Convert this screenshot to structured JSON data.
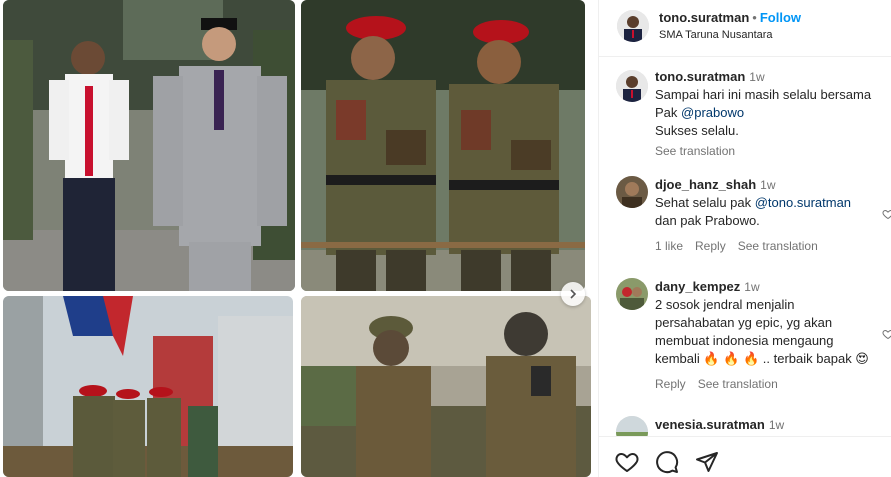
{
  "post": {
    "username": "tono.suratman",
    "separator": "•",
    "follow_label": "Follow",
    "location": "SMA Taruna Nusantara"
  },
  "comments": [
    {
      "username": "tono.suratman",
      "time": "1w",
      "lines": [
        "Sampai hari ini masih selalu bersama",
        "Pak @prabowo",
        "Sukses selalu."
      ],
      "see_translation": "See translation"
    },
    {
      "username": "djoe_hanz_shah",
      "time": "1w",
      "line1_pre": "Sehat selalu pak ",
      "line1_mention": "@tono.suratman",
      "line2": "dan pak Prabowo.",
      "likes": "1 like",
      "reply": "Reply",
      "see_translation": "See translation"
    },
    {
      "username": "dany_kempez",
      "time": "1w",
      "lines": [
        "2 sosok jendral menjalin",
        "persahabatan yg epic, yg akan",
        "membuat indonesia mengaung",
        "kembali 🔥 🔥 🔥 .. terbaik bapak 😍"
      ],
      "reply": "Reply",
      "see_translation": "See translation"
    },
    {
      "username": "venesia.suratman",
      "time": "1w"
    }
  ],
  "icons": {
    "next": "chevron-right-icon",
    "like": "heart-icon",
    "comment": "comment-icon",
    "share": "send-icon"
  },
  "colors": {
    "follow": "#0095f6",
    "mention": "#00376b",
    "muted": "#737373",
    "text": "#262626"
  }
}
